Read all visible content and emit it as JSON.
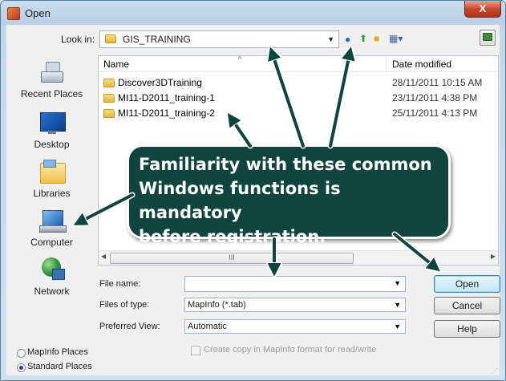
{
  "window": {
    "title": "Open",
    "close_label": "X"
  },
  "toolbar": {
    "look_in_label": "Look in:",
    "look_in_value": "GIS_TRAINING",
    "icons": [
      "back-icon",
      "up-folder-icon",
      "new-folder-icon",
      "view-menu-icon",
      "desktop-tool-icon"
    ]
  },
  "places": [
    {
      "label": "Recent Places",
      "icon": "recent-places-icon"
    },
    {
      "label": "Desktop",
      "icon": "desktop-icon"
    },
    {
      "label": "Libraries",
      "icon": "libraries-icon"
    },
    {
      "label": "Computer",
      "icon": "computer-icon"
    },
    {
      "label": "Network",
      "icon": "network-icon"
    }
  ],
  "file_list": {
    "columns": {
      "name": "Name",
      "date": "Date modified"
    },
    "rows": [
      {
        "name": "Discover3DTraining",
        "date": "28/11/2011 10:15 AM"
      },
      {
        "name": "MI11-D2011_training-1",
        "date": "23/11/2011 4:38 PM"
      },
      {
        "name": "MI11-D2011_training-2",
        "date": "25/11/2011 4:13 PM"
      }
    ],
    "scroll_thumb_mark": "III"
  },
  "form": {
    "file_name_label": "File name:",
    "file_name_value": "",
    "files_of_type_label": "Files of type:",
    "files_of_type_value": "MapInfo (*.tab)",
    "preferred_view_label": "Preferred View:",
    "preferred_view_value": "Automatic",
    "create_copy_label": "Create copy in MapInfo format for read/write"
  },
  "buttons": {
    "open": "Open",
    "cancel": "Cancel",
    "help": "Help"
  },
  "place_options": [
    {
      "label": "MapInfo Places",
      "selected": false
    },
    {
      "label": "Standard Places",
      "selected": true
    }
  ],
  "callout": {
    "lines": [
      "Familiarity with these common",
      "Windows functions is mandatory",
      "before registration."
    ],
    "background": "#10443f"
  }
}
